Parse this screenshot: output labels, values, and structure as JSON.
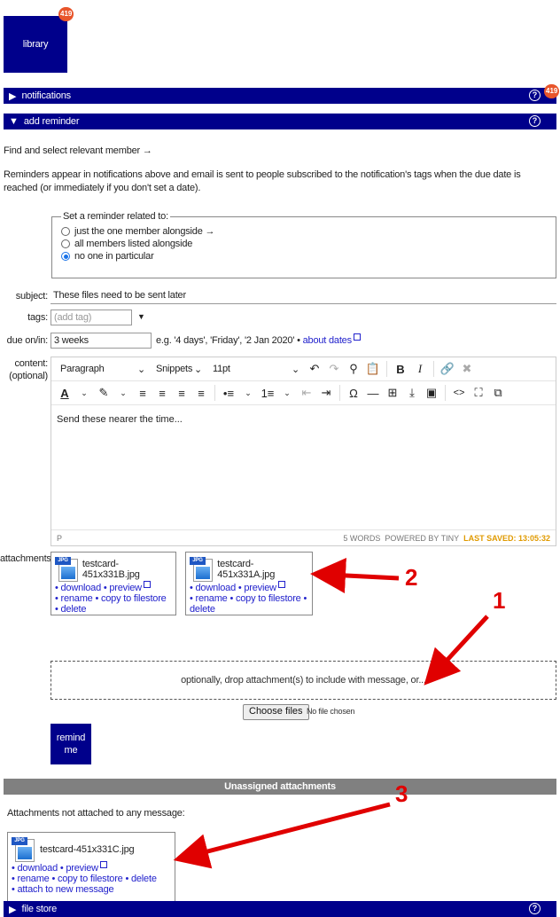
{
  "library": {
    "label": "library",
    "badge": "419"
  },
  "notifications_bar": {
    "label": "notifications",
    "badge": "419",
    "help": "?"
  },
  "reminder_bar": {
    "label": "add reminder",
    "help": "?"
  },
  "intro": {
    "find_member": "Find and select relevant member →",
    "description": "Reminders appear in notifications above and email is sent to people subscribed to the notification's tags when the due date is reached (or immediately if you don't set a date)."
  },
  "related": {
    "legend": "Set a reminder related to:",
    "options": [
      {
        "label": "just the one member alongside →",
        "selected": false
      },
      {
        "label": "all members listed alongside",
        "selected": false
      },
      {
        "label": "no one in particular",
        "selected": true
      }
    ]
  },
  "form": {
    "subject_label": "subject:",
    "subject_value": "These files need to be sent later",
    "tags_label": "tags:",
    "tags_placeholder": "(add tag)",
    "due_label": "due on/in:",
    "due_value": "3 weeks",
    "due_hint": "e.g. '4 days', 'Friday', '2 Jan 2020' •",
    "due_link": "about dates",
    "content_label": "content:",
    "content_optional": "(optional)"
  },
  "editor": {
    "block_format": "Paragraph",
    "snippets": "Snippets",
    "font_size": "11pt",
    "body_text": "Send these nearer the time...",
    "path": "P",
    "word_count": "5 WORDS",
    "powered": "POWERED BY TINY",
    "last_saved": "LAST SAVED: 13:05:32"
  },
  "attachments": {
    "label": "attachments:",
    "items": [
      {
        "filename": "testcard-451x331B.jpg",
        "line1": "• download • preview",
        "line2": "• rename • copy to filestore • delete"
      },
      {
        "filename": "testcard-451x331A.jpg",
        "line1": "• download • preview",
        "line2": "• rename • copy to filestore • delete"
      }
    ]
  },
  "dropzone": {
    "text": "optionally, drop attachment(s) to include with message, or...",
    "choose_button": "Choose files",
    "no_file": "No file chosen"
  },
  "remind_button": {
    "line1": "remind",
    "line2": "me"
  },
  "unassigned": {
    "title": "Unassigned attachments",
    "caption": "Attachments not attached to any message:",
    "item": {
      "filename": "testcard-451x331C.jpg",
      "line1": "• download • preview",
      "line2": "• rename • copy to filestore • delete",
      "line3": "• attach to new message"
    }
  },
  "filestore_bar": {
    "label": "file store",
    "help": "?"
  },
  "annotations": {
    "n1": "1",
    "n2": "2",
    "n3": "3"
  },
  "colors": {
    "bar": "#00008b",
    "badge": "#e8552b",
    "annotation": "#e00000",
    "link": "#2222cc"
  }
}
